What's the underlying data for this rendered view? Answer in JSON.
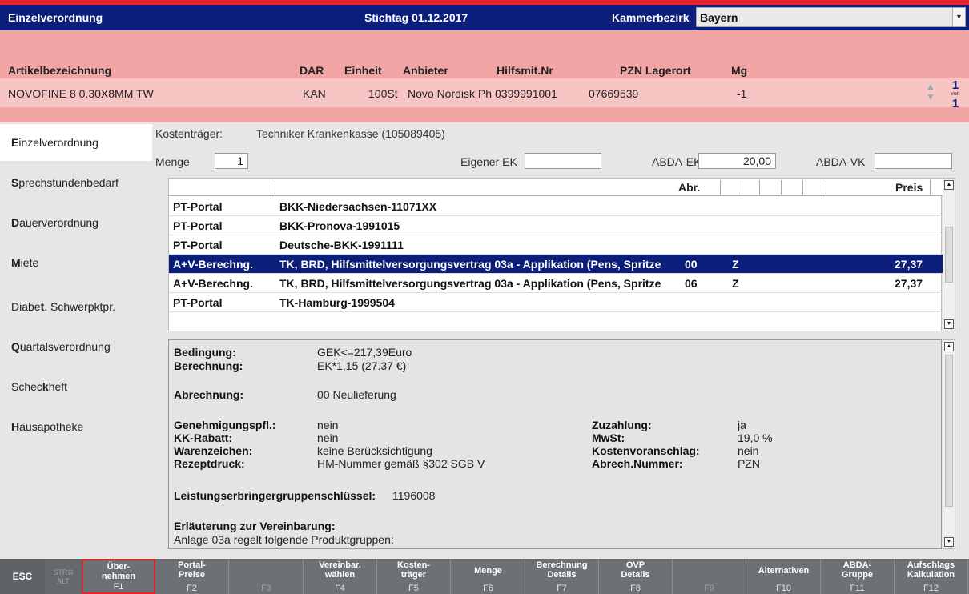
{
  "title": {
    "left": "Einzelverordnung",
    "stichtag": "Stichtag 01.12.2017",
    "kammerbezirk_label": "Kammerbezirk",
    "kammerbezirk_value": "Bayern"
  },
  "article": {
    "headers": {
      "bez": "Artikelbezeichnung",
      "dar": "DAR",
      "einheit": "Einheit",
      "anbieter": "Anbieter",
      "hilfsmit": "Hilfsmit.Nr",
      "pzn": "PZN Lagerort",
      "mg": "Mg"
    },
    "row": {
      "bez": "NOVOFINE 8 0.30X8MM TW",
      "dar": "KAN",
      "einheit": "100St",
      "anbieter": "Novo Nordisk Ph",
      "hilfsmit": "0399991001",
      "pzn": "07669539",
      "mg": "-1"
    },
    "pager": {
      "current": "1",
      "von": "von",
      "total": "1"
    }
  },
  "sidebar": [
    {
      "hot": "E",
      "rest": "inzelverordnung",
      "active": true
    },
    {
      "hot": "S",
      "rest": "prechstundenbedarf"
    },
    {
      "hot": "D",
      "rest": "auerverordnung"
    },
    {
      "hot": "M",
      "rest": "iete"
    },
    {
      "pre": "Diabe",
      "hot": "t",
      "rest": ". Schwerpktpr."
    },
    {
      "hot": "Q",
      "rest": "uartalsverordnung"
    },
    {
      "pre": "Schec",
      "hot": "k",
      "rest": "heft"
    },
    {
      "hot": "H",
      "rest": "ausapotheke"
    }
  ],
  "form": {
    "kostentraeger_label": "Kostenträger:",
    "kostentraeger_value": "Techniker Krankenkasse (105089405)",
    "menge_label": "Menge",
    "menge_value": "1",
    "eigener_ek_label": "Eigener EK",
    "eigener_ek_value": "",
    "abda_ek_label": "ABDA-EK",
    "abda_ek_value": "20,00",
    "abda_vk_label": "ABDA-VK",
    "abda_vk_value": ""
  },
  "table": {
    "headers": {
      "abr": "Abr.",
      "preis": "Preis"
    },
    "rows": [
      {
        "typ": "PT-Portal",
        "bez": "BKK-Niedersachsen-11071XX",
        "abr": "",
        "z": "",
        "preis": ""
      },
      {
        "typ": "PT-Portal",
        "bez": "BKK-Pronova-1991015",
        "abr": "",
        "z": "",
        "preis": ""
      },
      {
        "typ": "PT-Portal",
        "bez": "Deutsche-BKK-1991111",
        "abr": "",
        "z": "",
        "preis": ""
      },
      {
        "typ": "A+V-Berechng.",
        "bez": "TK, BRD, Hilfsmittelversorgungsvertrag 03a - Applikation (Pens, Spritze",
        "abr": "00",
        "z": "Z",
        "preis": "27,37",
        "selected": true
      },
      {
        "typ": "A+V-Berechng.",
        "bez": "TK, BRD, Hilfsmittelversorgungsvertrag 03a - Applikation (Pens, Spritze",
        "abr": "06",
        "z": "Z",
        "preis": "27,37"
      },
      {
        "typ": "PT-Portal",
        "bez": "TK-Hamburg-1999504",
        "abr": "",
        "z": "",
        "preis": ""
      }
    ]
  },
  "details": {
    "bedingung_label": "Bedingung:",
    "bedingung_value": "GEK<=217,39Euro",
    "berechnung_label": "Berechnung:",
    "berechnung_value": "EK*1,15 (27.37 €)",
    "abrechnung_label": "Abrechnung:",
    "abrechnung_value": "00 Neulieferung",
    "genehm_label": "Genehmigungspfl.:",
    "genehm_value": "nein",
    "kkrabatt_label": "KK-Rabatt:",
    "kkrabatt_value": "nein",
    "warenz_label": "Warenzeichen:",
    "warenz_value": "keine Berücksichtigung",
    "rezept_label": "Rezeptdruck:",
    "rezept_value": "HM-Nummer gemäß §302 SGB V",
    "zuzahlung_label": "Zuzahlung:",
    "zuzahlung_value": "ja",
    "mwst_label": "MwSt:",
    "mwst_value": "19,0 %",
    "kva_label": "Kostenvoranschlag:",
    "kva_value": "nein",
    "abrechnr_label": "Abrech.Nummer:",
    "abrechnr_value": "PZN",
    "leg_label": "Leistungserbringergruppenschlüssel:",
    "leg_value": "1196008",
    "erl_label": "Erläuterung zur Vereinbarung:",
    "erl_text": "Anlage 03a regelt folgende Produktgruppen:"
  },
  "fkeys": {
    "esc": "ESC",
    "strg": "STRG",
    "alt": "ALT",
    "keys": [
      {
        "l1": "Über-",
        "l2": "nehmen",
        "key": "F1"
      },
      {
        "l1": "Portal-",
        "l2": "Preise",
        "key": "F2"
      },
      {
        "l1": "",
        "l2": "",
        "key": "F3"
      },
      {
        "l1": "Vereinbar.",
        "l2": "wählen",
        "key": "F4"
      },
      {
        "l1": "Kosten-",
        "l2": "träger",
        "key": "F5"
      },
      {
        "l1": "",
        "l2": "Menge",
        "key": "F6"
      },
      {
        "l1": "Berechnung",
        "l2": "Details",
        "key": "F7"
      },
      {
        "l1": "OVP",
        "l2": "Details",
        "key": "F8"
      },
      {
        "l1": "",
        "l2": "",
        "key": "F9"
      },
      {
        "l1": "",
        "l2": "Alternativen",
        "key": "F10"
      },
      {
        "l1": "ABDA-",
        "l2": "Gruppe",
        "key": "F11"
      },
      {
        "l1": "Aufschlags",
        "l2": "Kalkulation",
        "key": "F12"
      }
    ]
  }
}
